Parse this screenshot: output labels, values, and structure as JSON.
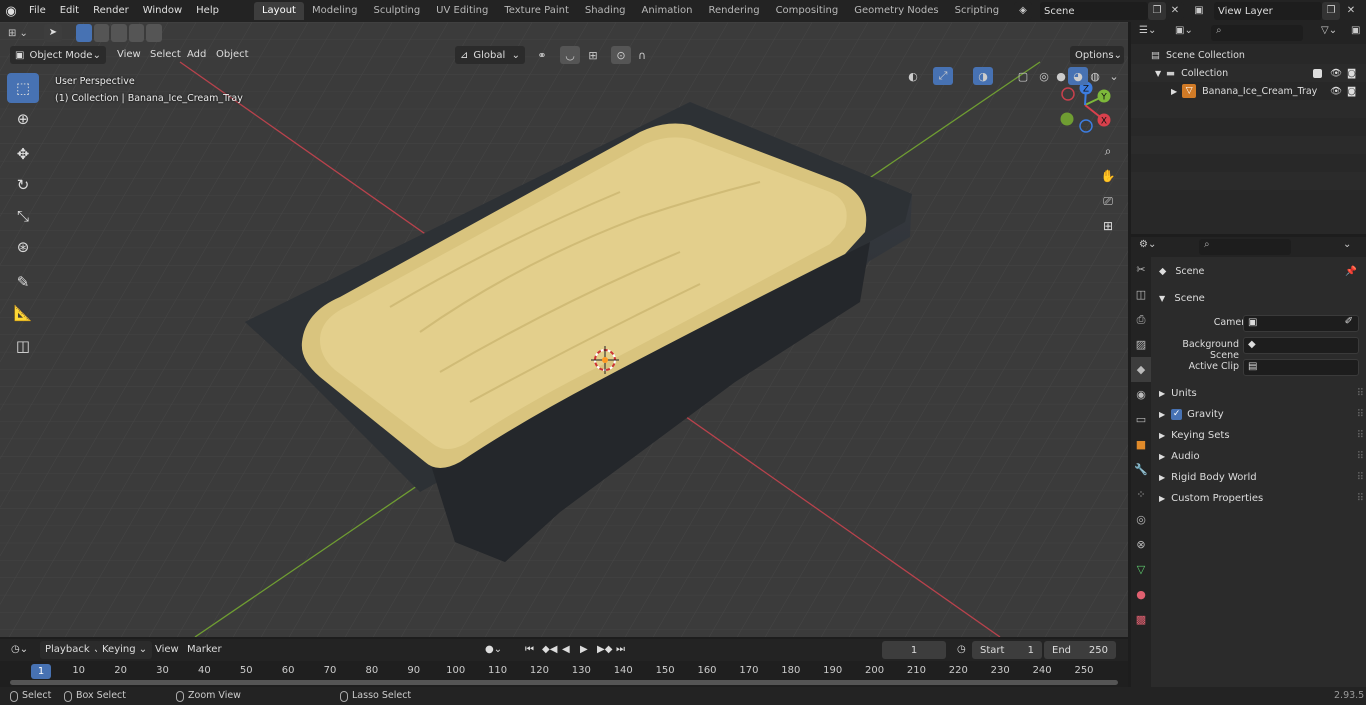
{
  "topbar": {
    "menus": [
      "File",
      "Edit",
      "Render",
      "Window",
      "Help"
    ],
    "workspaces": [
      "Layout",
      "Modeling",
      "Sculpting",
      "UV Editing",
      "Texture Paint",
      "Shading",
      "Animation",
      "Rendering",
      "Compositing",
      "Geometry Nodes",
      "Scripting"
    ],
    "active_workspace": "Layout",
    "add_tab": "+",
    "scene": "Scene",
    "view_layer": "View Layer"
  },
  "viewport": {
    "mode": "Object Mode",
    "menus": [
      "View",
      "Select",
      "Add",
      "Object"
    ],
    "transform_orientation": "Global",
    "options": "Options",
    "overlay_line1": "User Perspective",
    "overlay_line2": "(1) Collection | Banana_Ice_Cream_Tray",
    "gizmo_axes": [
      "Z",
      "Y",
      "X"
    ]
  },
  "outliner": {
    "scene_collection": "Scene Collection",
    "collection": "Collection",
    "object": "Banana_Ice_Cream_Tray"
  },
  "properties": {
    "breadcrumb": "Scene",
    "panel_title": "Scene",
    "camera_label": "Camera",
    "bg_scene_label": "Background Scene",
    "active_clip_label": "Active Clip",
    "subpanels": [
      "Units",
      "Gravity",
      "Keying Sets",
      "Audio",
      "Rigid Body World",
      "Custom Properties"
    ]
  },
  "timeline": {
    "menus": [
      "Playback",
      "Keying",
      "View",
      "Marker"
    ],
    "current_frame": "1",
    "start_label": "Start",
    "start_value": "1",
    "end_label": "End",
    "end_value": "250",
    "ruler_ticks": [
      "1",
      "10",
      "20",
      "30",
      "40",
      "50",
      "60",
      "70",
      "80",
      "90",
      "100",
      "110",
      "120",
      "130",
      "140",
      "150",
      "160",
      "170",
      "180",
      "190",
      "200",
      "210",
      "220",
      "230",
      "240",
      "250"
    ]
  },
  "statusbar": {
    "select": "Select",
    "box_select": "Box Select",
    "zoom_view": "Zoom View",
    "lasso_select": "Lasso Select",
    "version": "2.93.5"
  },
  "colors": {
    "accent": "#4772b3",
    "tray": "#2f3338",
    "ice_cream": "#e0cc84",
    "x_axis": "#c8404c",
    "y_axis": "#7db83a"
  }
}
